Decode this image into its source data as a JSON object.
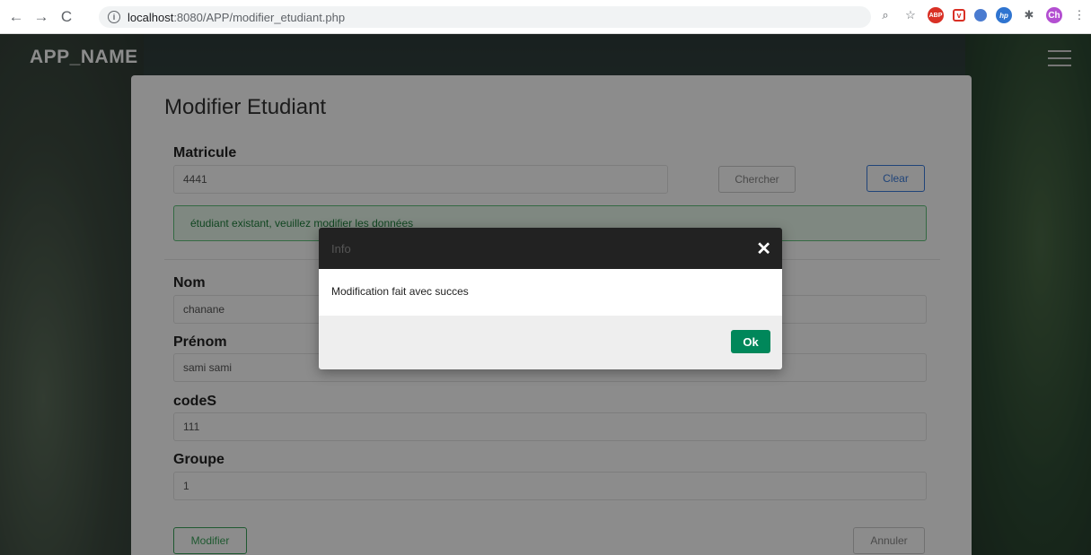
{
  "browser": {
    "url_host": "localhost",
    "url_path": ":8080/APP/modifier_etudiant.php",
    "avatar_text": "Ch",
    "abp_text": "ABP"
  },
  "app": {
    "name": "APP_NAME"
  },
  "form": {
    "title": "Modifier Etudiant",
    "matricule_label": "Matricule",
    "matricule_value": "4441",
    "chercher_label": "Chercher",
    "clear_label": "Clear",
    "alert_text": "étudiant existant, veuillez modifier les données",
    "nom_label": "Nom",
    "nom_value": "chanane",
    "prenom_label": "Prénom",
    "prenom_value": "sami sami",
    "codes_label": "codeS",
    "codes_value": "111",
    "groupe_label": "Groupe",
    "groupe_value": "1",
    "modifier_label": "Modifier",
    "annuler_label": "Annuler"
  },
  "modal": {
    "title": "Info",
    "close_symbol": "✕",
    "message": "Modification fait avec succes",
    "ok_label": "Ok"
  },
  "colors": {
    "alert_green": "#1e7f3b",
    "ok_button": "#00875a",
    "clear_blue": "#3b7ddd"
  }
}
